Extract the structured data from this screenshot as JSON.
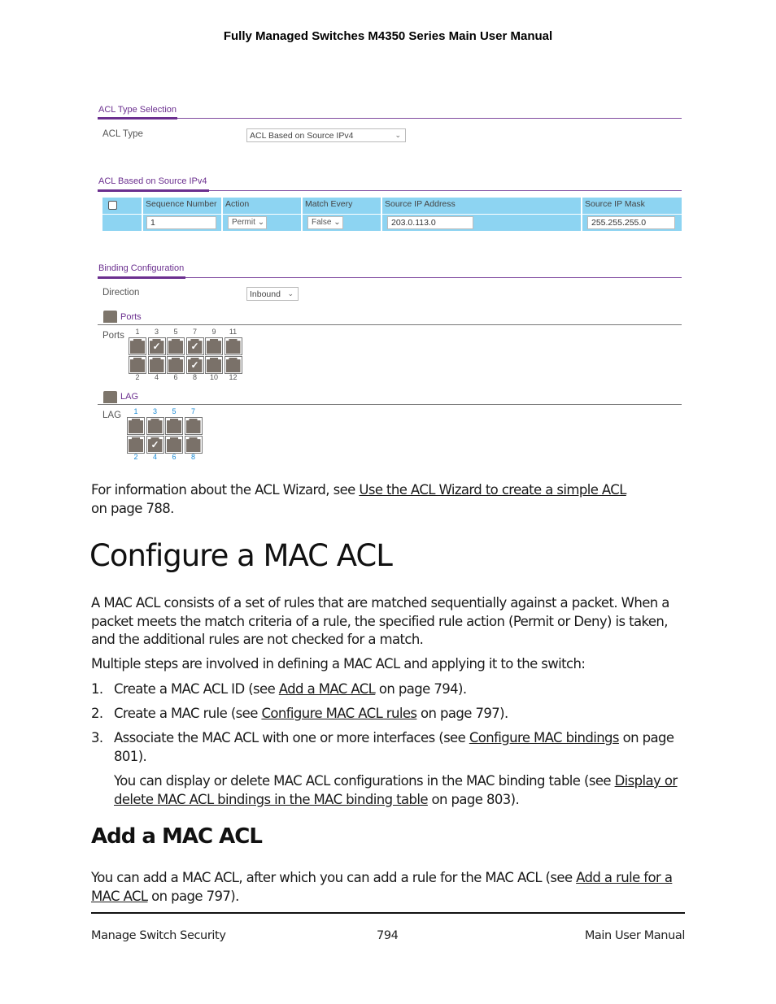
{
  "header": {
    "title": "Fully Managed Switches M4350 Series Main User Manual"
  },
  "acl_type_selection": {
    "section_title": "ACL Type Selection",
    "acl_type_label": "ACL Type",
    "acl_type_value": "ACL Based on Source IPv4"
  },
  "acl_source_ipv4": {
    "section_title": "ACL Based on Source IPv4",
    "columns": [
      "Sequence Number",
      "Action",
      "Match Every",
      "Source IP Address",
      "Source IP Mask"
    ],
    "row": {
      "sequence_number": "1",
      "action": "Permit",
      "match_every": "False",
      "source_ip_address": "203.0.113.0",
      "source_ip_mask": "255.255.255.0"
    }
  },
  "binding_configuration": {
    "section_title": "Binding Configuration",
    "direction_label": "Direction",
    "direction_value": "Inbound",
    "ports_group_title": "Ports",
    "ports_label": "Ports",
    "ports": [
      {
        "num": "1",
        "checked": false
      },
      {
        "num": "2",
        "checked": false
      },
      {
        "num": "3",
        "checked": true
      },
      {
        "num": "4",
        "checked": false
      },
      {
        "num": "5",
        "checked": false
      },
      {
        "num": "6",
        "checked": false
      },
      {
        "num": "7",
        "checked": true
      },
      {
        "num": "8",
        "checked": true
      },
      {
        "num": "9",
        "checked": false
      },
      {
        "num": "10",
        "checked": false
      },
      {
        "num": "11",
        "checked": false
      },
      {
        "num": "12",
        "checked": false
      }
    ],
    "lag_group_title": "LAG",
    "lag_label": "LAG",
    "lags": [
      {
        "num": "1",
        "checked": false
      },
      {
        "num": "2",
        "checked": false
      },
      {
        "num": "3",
        "checked": false
      },
      {
        "num": "4",
        "checked": true
      },
      {
        "num": "5",
        "checked": false
      },
      {
        "num": "6",
        "checked": false
      },
      {
        "num": "7",
        "checked": false
      },
      {
        "num": "8",
        "checked": false
      }
    ],
    "check_glyph": "✓"
  },
  "wizard_para": {
    "before": "For information about the ACL Wizard, see ",
    "link": "Use the ACL Wizard to create a simple ACL",
    "after": "on page 788."
  },
  "section_configure": {
    "title": "Configure a MAC ACL",
    "para1": "A MAC ACL consists of a set of rules that are matched sequentially against a packet. When a packet meets the match criteria of a rule, the specified rule action (Permit or Deny) is taken, and the additional rules are not checked for a match.",
    "para2": "Multiple steps are involved in defining a MAC ACL and applying it to the switch:",
    "steps": [
      {
        "num": "1.",
        "before": "Create a MAC ACL ID (see ",
        "link": "Add a MAC ACL",
        "after": " on page 794)."
      },
      {
        "num": "2.",
        "before": "Create a MAC rule (see ",
        "link": "Configure MAC ACL rules",
        "after": " on page 797)."
      },
      {
        "num": "3.",
        "before": "Associate the MAC ACL with one or more interfaces (see ",
        "link": "Configure MAC bindings",
        "after": " on page 801)."
      }
    ],
    "step3_note": {
      "before": "You can display or delete MAC ACL configurations in the MAC binding table (see ",
      "link": "Display or delete MAC ACL bindings in the MAC binding table",
      "after": " on page 803)."
    }
  },
  "section_add": {
    "title": "Add a MAC ACL",
    "para": {
      "before": "You can add a MAC ACL, after which you can add a rule for the MAC ACL (see ",
      "link": "Add a rule for a MAC ACL",
      "after": " on page 797)."
    }
  },
  "footer": {
    "left": "Manage Switch Security",
    "center": "794",
    "right": "Main User Manual"
  }
}
